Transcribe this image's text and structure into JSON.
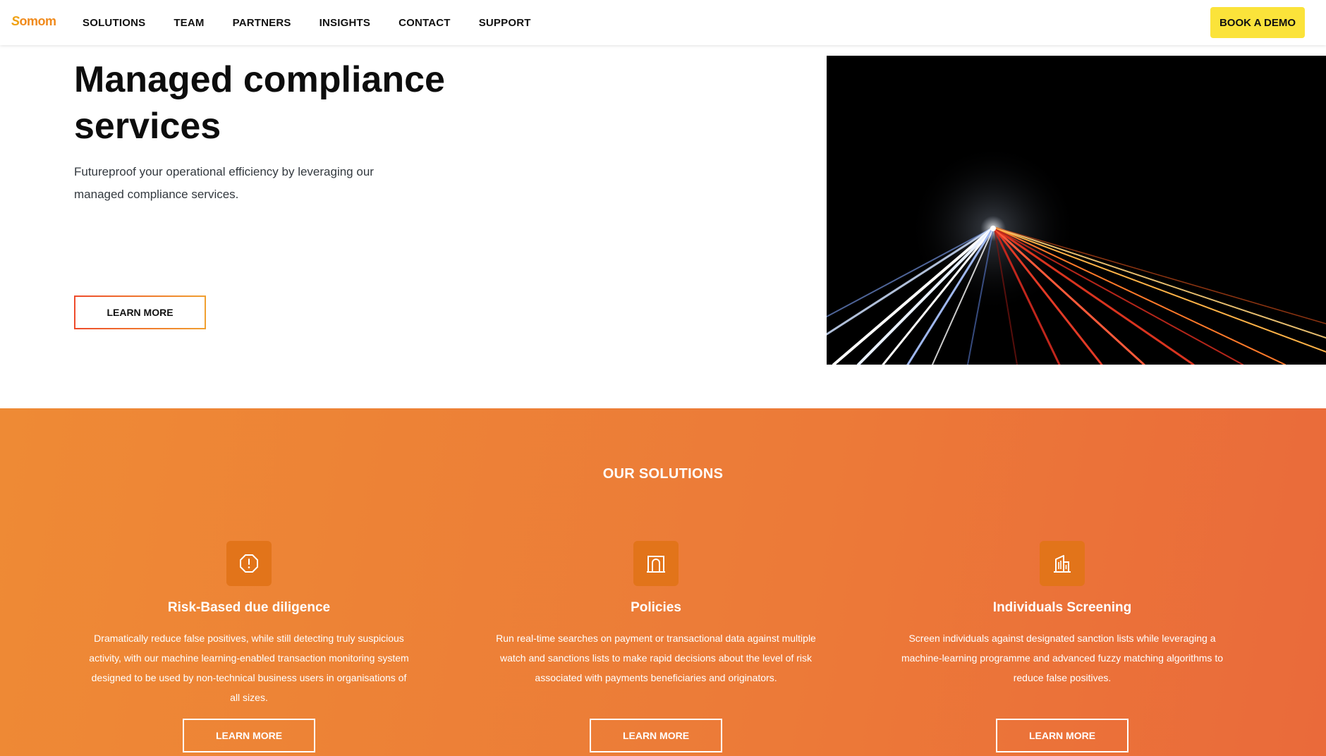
{
  "brand": {
    "logo_text": "omom",
    "logo_mark": "S",
    "accent": "#f08a1c",
    "cta_color": "#fbe33a",
    "section_gradient": [
      "#ee8a35",
      "#ea6a3a"
    ]
  },
  "nav": {
    "items": [
      "SOLUTIONS",
      "TEAM",
      "PARTNERS",
      "INSIGHTS",
      "CONTACT",
      "SUPPORT"
    ],
    "cta": "BOOK A DEMO"
  },
  "hero": {
    "title_line1": "Managed compliance",
    "title_line2": "services",
    "subtitle_line1": "Futureproof your operational efficiency by leveraging our",
    "subtitle_line2": "managed compliance services.",
    "button": "LEARN MORE"
  },
  "solutions": {
    "heading": "OUR SOLUTIONS",
    "cards": [
      {
        "icon": "alert-octagon-icon",
        "title": "Risk-Based due diligence",
        "lines": [
          "Dramatically reduce false positives, while still detecting truly suspicious",
          "activity, with our machine learning-enabled transaction monitoring system",
          "designed to be used by non-technical business users in organisations of",
          "all sizes."
        ],
        "button": "LEARN MORE"
      },
      {
        "icon": "door-icon",
        "title": "Policies",
        "lines": [
          "Run real-time searches on payment or transactional data against multiple",
          "watch and sanctions lists to make rapid decisions about the level of risk",
          "associated with payments beneficiaries and originators."
        ],
        "button": "LEARN MORE"
      },
      {
        "icon": "building-icon",
        "title": "Individuals Screening",
        "lines": [
          "Screen individuals against designated sanction lists while leveraging a",
          "machine-learning programme and advanced fuzzy matching algorithms to",
          "reduce false positives."
        ],
        "button": "LEARN MORE"
      }
    ]
  }
}
